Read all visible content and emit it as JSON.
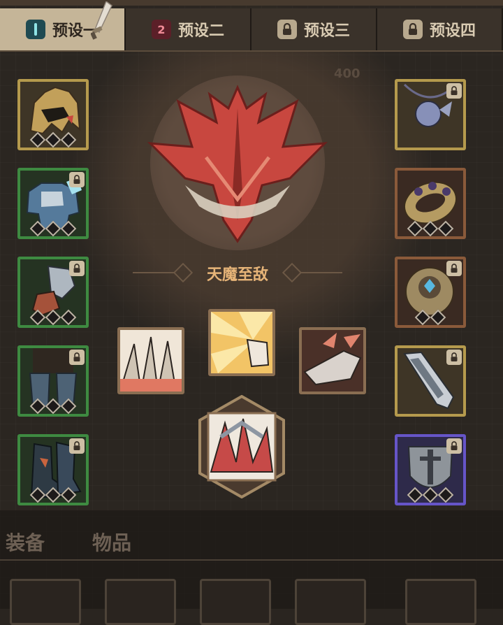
{
  "tabs": [
    {
      "label": "预设一",
      "icon": "teal-marker-icon",
      "active": true
    },
    {
      "label": "预设二",
      "icon": "red-two-icon",
      "active": false
    },
    {
      "label": "预设三",
      "icon": "lock-icon",
      "active": false
    },
    {
      "label": "预设四",
      "icon": "lock-icon",
      "active": false
    }
  ],
  "tab_icon_text": {
    "preset2": "2"
  },
  "emblem": {
    "title": "天魔至敌",
    "background_number": "400"
  },
  "bottom_tabs": {
    "equipment": "装备",
    "items": "物品"
  },
  "colors": {
    "gold": "#b59a4d",
    "green": "#3e8a41",
    "bronze": "#8a5a3a",
    "purple": "#6655c8",
    "title": "#e6b478",
    "emblem_red": "#c8473f"
  }
}
